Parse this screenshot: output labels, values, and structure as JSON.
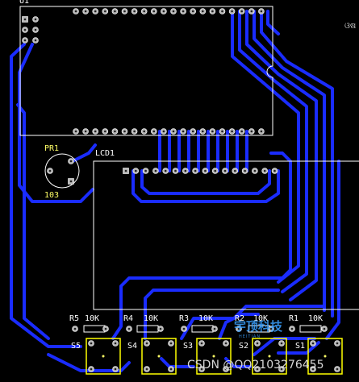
{
  "board": {
    "header_id": "U1",
    "lcd_label": "LCD1",
    "pot_ref": "PR1",
    "pot_value": "103",
    "corner_mark": "ଓଷ"
  },
  "resistors": [
    {
      "ref": "R5",
      "value": "10K"
    },
    {
      "ref": "R4",
      "value": "10K"
    },
    {
      "ref": "R3",
      "value": "10K"
    },
    {
      "ref": "R2",
      "value": "10K"
    },
    {
      "ref": "R1",
      "value": "10K"
    }
  ],
  "switches": [
    {
      "ref": "S5"
    },
    {
      "ref": "S4"
    },
    {
      "ref": "S3"
    },
    {
      "ref": "S2"
    },
    {
      "ref": "S1"
    }
  ],
  "watermark": {
    "text": "CSDN @QQ2103276455",
    "logo_text": "宇顶科技",
    "logo_sub": "HEITIAN"
  },
  "colors": {
    "background": "#000000",
    "trace": "#1a2cff",
    "silkscreen": "#ffffff",
    "label": "#ffff66",
    "pad": "#b8b8b8"
  }
}
